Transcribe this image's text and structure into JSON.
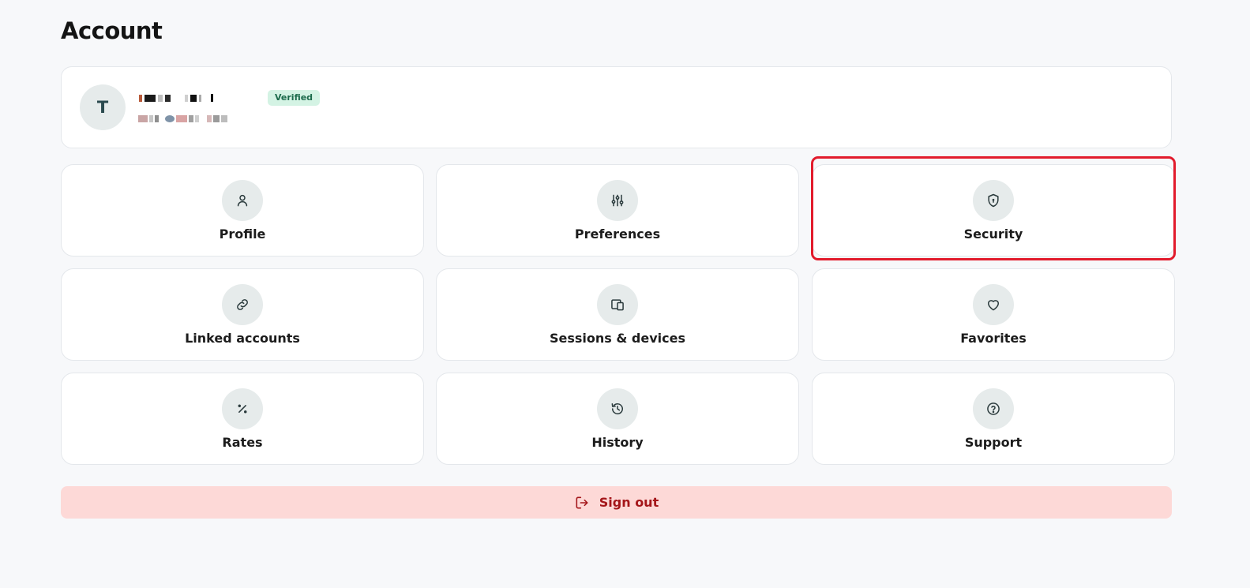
{
  "page": {
    "title": "Account"
  },
  "user": {
    "avatar_initial": "T",
    "verified_label": "Verified"
  },
  "tiles": [
    {
      "label": "Profile",
      "icon": "user-icon"
    },
    {
      "label": "Preferences",
      "icon": "sliders-icon"
    },
    {
      "label": "Security",
      "icon": "shield-lock-icon"
    },
    {
      "label": "Linked accounts",
      "icon": "link-icon"
    },
    {
      "label": "Sessions & devices",
      "icon": "devices-icon"
    },
    {
      "label": "Favorites",
      "icon": "heart-icon"
    },
    {
      "label": "Rates",
      "icon": "percent-icon"
    },
    {
      "label": "History",
      "icon": "history-icon"
    },
    {
      "label": "Support",
      "icon": "help-circle-icon"
    }
  ],
  "signout": {
    "label": "Sign out",
    "icon": "logout-icon"
  },
  "colors": {
    "background": "#f7f8fa",
    "tile_icon_bg": "#e6ebeb",
    "verified_bg": "#d4f3e4",
    "verified_text": "#1d6b4c",
    "signout_bg": "#fdd9d7",
    "signout_text": "#a4161a",
    "highlight": "#e21b2c"
  }
}
